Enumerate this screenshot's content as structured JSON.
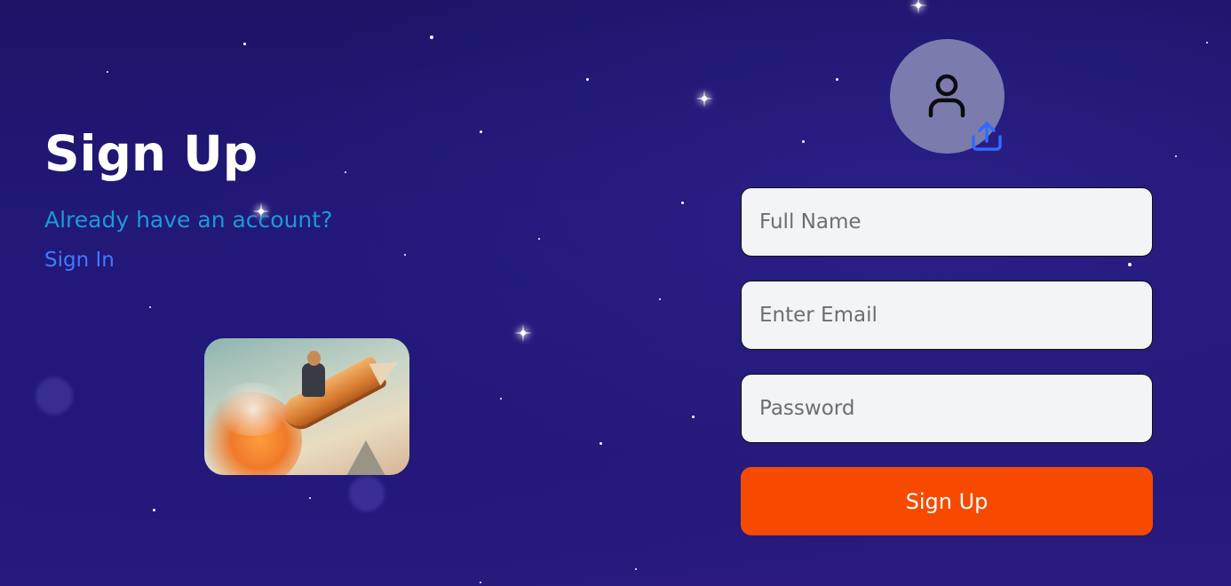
{
  "heading": {
    "title": "Sign Up",
    "subtitle": "Already have an account?",
    "signin_link": "Sign In"
  },
  "avatar": {
    "icon": "user-icon",
    "upload_icon": "upload-icon"
  },
  "form": {
    "full_name": {
      "placeholder": "Full Name",
      "value": ""
    },
    "email": {
      "placeholder": "Enter Email",
      "value": ""
    },
    "password": {
      "placeholder": "Password",
      "value": ""
    },
    "submit_label": "Sign Up"
  },
  "colors": {
    "background": "#1e1670",
    "subtitle": "#1b9ad6",
    "link": "#3f7bff",
    "button": "#f64a00",
    "input_bg": "#f3f4f6",
    "avatar_bg": "#7b7cad",
    "upload_icon": "#2f6bff"
  }
}
